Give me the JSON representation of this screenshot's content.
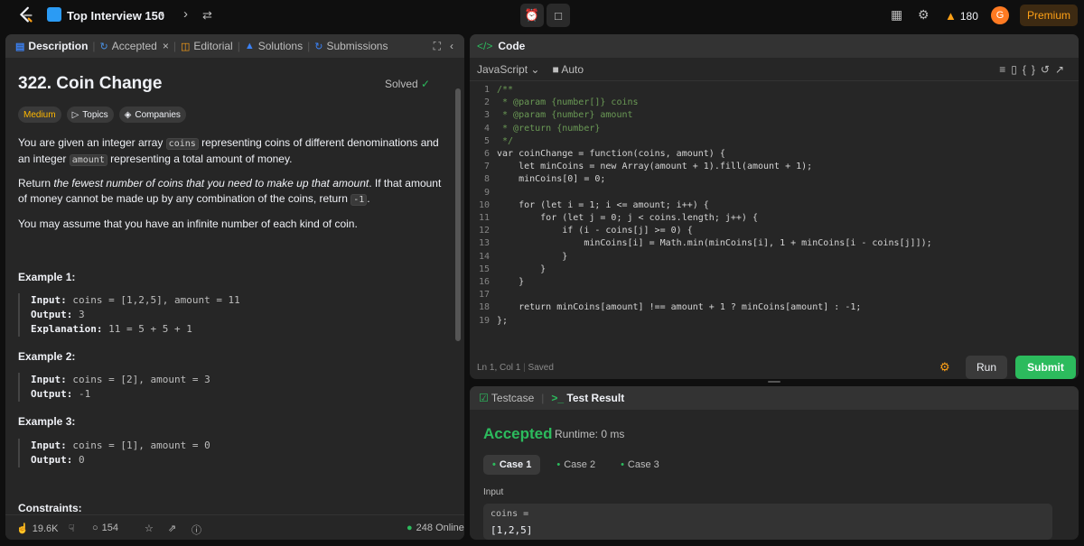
{
  "topbar": {
    "list_title": "Top Interview 150",
    "streak": "180",
    "avatar_letter": "G",
    "premium_label": "Premium"
  },
  "tabs": {
    "description": "Description",
    "accepted": "Accepted",
    "editorial": "Editorial",
    "solutions": "Solutions",
    "submissions": "Submissions"
  },
  "problem": {
    "title": "322. Coin Change",
    "solved_label": "Solved",
    "difficulty": "Medium",
    "topics": "Topics",
    "companies": "Companies",
    "p1_a": "You are given an integer array ",
    "p1_code1": "coins",
    "p1_b": " representing coins of different denominations and an integer ",
    "p1_code2": "amount",
    "p1_c": " representing a total amount of money.",
    "p2_a": "Return ",
    "p2_em": "the fewest number of coins that you need to make up that amount",
    "p2_b": ". If that amount of money cannot be made up by any combination of the coins, return ",
    "p2_code": "-1",
    "p2_c": ".",
    "p3": "You may assume that you have an infinite number of each kind of coin.",
    "ex1_title": "Example 1:",
    "ex1_input_label": "Input:",
    "ex1_input": " coins = [1,2,5], amount = 11",
    "ex1_output_label": "Output:",
    "ex1_output": " 3",
    "ex1_expl_label": "Explanation:",
    "ex1_expl": " 11 = 5 + 5 + 1",
    "ex2_title": "Example 2:",
    "ex2_input_label": "Input:",
    "ex2_input": " coins = [2], amount = 3",
    "ex2_output_label": "Output:",
    "ex2_output": " -1",
    "ex3_title": "Example 3:",
    "ex3_input_label": "Input:",
    "ex3_input": " coins = [1], amount = 0",
    "ex3_output_label": "Output:",
    "ex3_output": " 0",
    "constraints": "Constraints:"
  },
  "footer": {
    "likes": "19.6K",
    "comments": "154",
    "online": "248 Online"
  },
  "code": {
    "header": "Code",
    "language": "JavaScript",
    "auto": "Auto",
    "status_pos": "Ln 1, Col 1",
    "status_saved": "Saved",
    "lines": [
      "/**",
      " * @param {number[]} coins",
      " * @param {number} amount",
      " * @return {number}",
      " */",
      "var coinChange = function(coins, amount) {",
      "    let minCoins = new Array(amount + 1).fill(amount + 1);",
      "    minCoins[0] = 0;",
      "",
      "    for (let i = 1; i <= amount; i++) {",
      "        for (let j = 0; j < coins.length; j++) {",
      "            if (i - coins[j] >= 0) {",
      "                minCoins[i] = Math.min(minCoins[i], 1 + minCoins[i - coins[j]]);",
      "            }",
      "        }",
      "    }",
      "",
      "    return minCoins[amount] !== amount + 1 ? minCoins[amount] : -1;",
      "};"
    ],
    "run_label": "Run",
    "submit_label": "Submit"
  },
  "result": {
    "testcase_tab": "Testcase",
    "result_tab": "Test Result",
    "verdict": "Accepted",
    "runtime": "Runtime: 0 ms",
    "cases": [
      "Case 1",
      "Case 2",
      "Case 3"
    ],
    "input_label": "Input",
    "input_var": "coins =",
    "input_value": "[1,2,5]"
  },
  "colors": {
    "accent_green": "#2cbb5d",
    "accent_orange": "#ffa116",
    "medium_yellow": "#ffb800"
  }
}
